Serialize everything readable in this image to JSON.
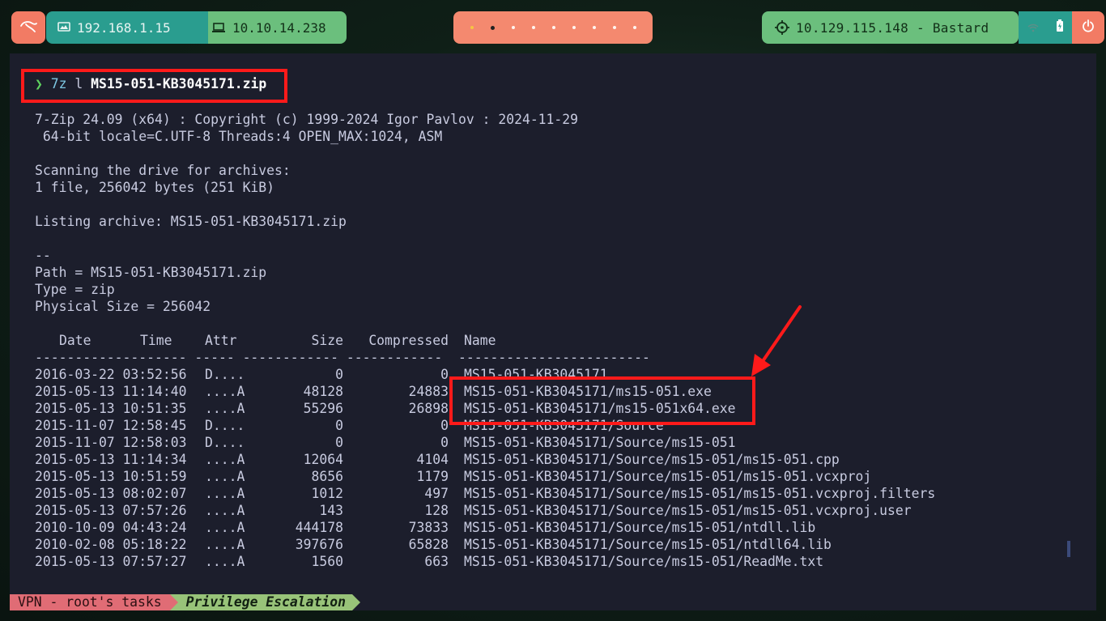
{
  "topbar": {
    "host_ip": "192.168.1.15",
    "vpn_ip": "10.10.14.238",
    "target": "10.129.115.148 - Bastard",
    "workspace_count": 9,
    "active_workspace": 1
  },
  "terminal": {
    "prompt_symbol": "❯",
    "command_bin": "7z",
    "command_arg": "l",
    "command_file": "MS15-051-KB3045171.zip",
    "header_lines": [
      "7-Zip 24.09 (x64) : Copyright (c) 1999-2024 Igor Pavlov : 2024-11-29",
      " 64-bit locale=C.UTF-8 Threads:4 OPEN_MAX:1024, ASM",
      "",
      "Scanning the drive for archives:",
      "1 file, 256042 bytes (251 KiB)",
      "",
      "Listing archive: MS15-051-KB3045171.zip",
      "",
      "--",
      "Path = MS15-051-KB3045171.zip",
      "Type = zip",
      "Physical Size = 256042"
    ],
    "table_headers": {
      "date": "Date",
      "time": "Time",
      "attr": "Attr",
      "size": "Size",
      "compressed": "Compressed",
      "name": "Name"
    },
    "separator": "------------------- ----- ------------ ------------  ------------------------",
    "rows": [
      {
        "datetime": "2016-03-22 03:52:56",
        "attr": "D....",
        "size": "0",
        "compressed": "0",
        "name": "MS15-051-KB3045171"
      },
      {
        "datetime": "2015-05-13 11:14:40",
        "attr": "....A",
        "size": "48128",
        "compressed": "24883",
        "name": "MS15-051-KB3045171/ms15-051.exe"
      },
      {
        "datetime": "2015-05-13 10:51:35",
        "attr": "....A",
        "size": "55296",
        "compressed": "26898",
        "name": "MS15-051-KB3045171/ms15-051x64.exe"
      },
      {
        "datetime": "2015-11-07 12:58:45",
        "attr": "D....",
        "size": "0",
        "compressed": "0",
        "name": "MS15-051-KB3045171/Source"
      },
      {
        "datetime": "2015-11-07 12:58:03",
        "attr": "D....",
        "size": "0",
        "compressed": "0",
        "name": "MS15-051-KB3045171/Source/ms15-051"
      },
      {
        "datetime": "2015-05-13 11:14:34",
        "attr": "....A",
        "size": "12064",
        "compressed": "4104",
        "name": "MS15-051-KB3045171/Source/ms15-051/ms15-051.cpp"
      },
      {
        "datetime": "2015-05-13 10:51:59",
        "attr": "....A",
        "size": "8656",
        "compressed": "1179",
        "name": "MS15-051-KB3045171/Source/ms15-051/ms15-051.vcxproj"
      },
      {
        "datetime": "2015-05-13 08:02:07",
        "attr": "....A",
        "size": "1012",
        "compressed": "497",
        "name": "MS15-051-KB3045171/Source/ms15-051/ms15-051.vcxproj.filters"
      },
      {
        "datetime": "2015-05-13 07:57:26",
        "attr": "....A",
        "size": "143",
        "compressed": "128",
        "name": "MS15-051-KB3045171/Source/ms15-051/ms15-051.vcxproj.user"
      },
      {
        "datetime": "2010-10-09 04:43:24",
        "attr": "....A",
        "size": "444178",
        "compressed": "73833",
        "name": "MS15-051-KB3045171/Source/ms15-051/ntdll.lib"
      },
      {
        "datetime": "2010-02-08 05:18:22",
        "attr": "....A",
        "size": "397676",
        "compressed": "65828",
        "name": "MS15-051-KB3045171/Source/ms15-051/ntdll64.lib"
      },
      {
        "datetime": "2015-05-13 07:57:27",
        "attr": "....A",
        "size": "1560",
        "compressed": "663",
        "name": "MS15-051-KB3045171/Source/ms15-051/ReadMe.txt"
      }
    ]
  },
  "statusline": {
    "session": "VPN - root's tasks",
    "window": "Privilege Escalation"
  },
  "colors": {
    "highlight": "#ff1a1a",
    "terminal_bg": "#1c1e2c",
    "accent_teal": "#2a9d8f",
    "accent_green": "#6bbf7d",
    "accent_salmon": "#f27b64"
  },
  "icons": [
    "kali-dragon-icon",
    "monitor-icon",
    "laptop-icon",
    "crosshair-icon",
    "network-icon",
    "battery-icon",
    "power-icon"
  ]
}
